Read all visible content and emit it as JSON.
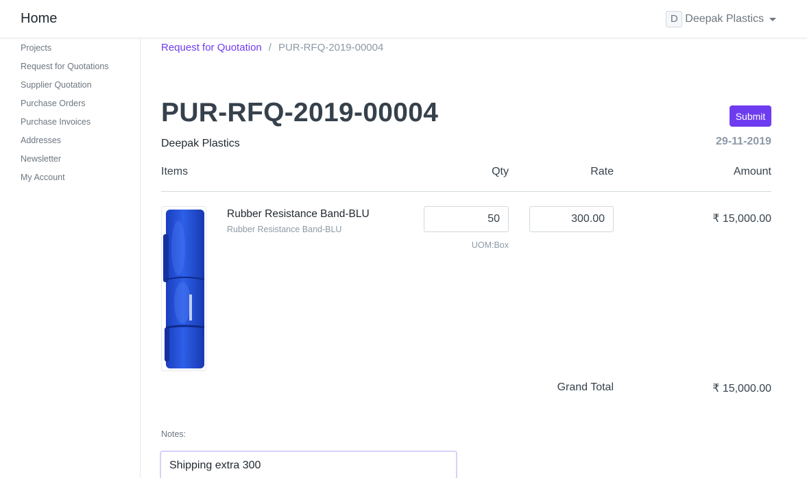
{
  "navbar": {
    "brand": "Home",
    "user_initial": "D",
    "user_name": "Deepak Plastics"
  },
  "sidebar": {
    "items": [
      {
        "label": "Projects"
      },
      {
        "label": "Request for Quotations"
      },
      {
        "label": "Supplier Quotation"
      },
      {
        "label": "Purchase Orders"
      },
      {
        "label": "Purchase Invoices"
      },
      {
        "label": "Addresses"
      },
      {
        "label": "Newsletter"
      },
      {
        "label": "My Account"
      }
    ]
  },
  "breadcrumb": {
    "parent": "Request for Quotation",
    "separator": "/",
    "current": "PUR-RFQ-2019-00004"
  },
  "document": {
    "title": "PUR-RFQ-2019-00004",
    "submit_label": "Submit",
    "supplier": "Deepak Plastics",
    "date": "29-11-2019"
  },
  "items_table": {
    "headers": {
      "items": "Items",
      "qty": "Qty",
      "rate": "Rate",
      "amount": "Amount"
    },
    "rows": [
      {
        "name": "Rubber Resistance Band-BLU",
        "description": "Rubber Resistance Band-BLU",
        "qty": "50",
        "rate": "300.00",
        "uom": "UOM:Box",
        "amount": "₹ 15,000.00",
        "image_icon": "resistance-band-image"
      }
    ]
  },
  "totals": {
    "grand_total_label": "Grand Total",
    "grand_total_value": "₹ 15,000.00"
  },
  "notes": {
    "label": "Notes:",
    "value": "Shipping extra 300"
  },
  "colors": {
    "accent": "#6e3cf0",
    "muted_text": "#8d99a6",
    "band_blue": "#1f4fd6"
  }
}
